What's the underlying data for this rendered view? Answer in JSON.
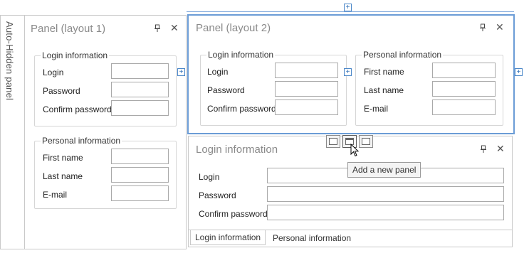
{
  "auto_hidden": {
    "label": "Auto-Hidden panel"
  },
  "panel1": {
    "title": "Panel (layout 1)",
    "login_group": {
      "caption": "Login information",
      "fields": [
        {
          "label": "Login",
          "value": ""
        },
        {
          "label": "Password",
          "value": ""
        },
        {
          "label": "Confirm password",
          "value": ""
        }
      ]
    },
    "personal_group": {
      "caption": "Personal information",
      "fields": [
        {
          "label": "First name",
          "value": ""
        },
        {
          "label": "Last name",
          "value": ""
        },
        {
          "label": "E-mail",
          "value": ""
        }
      ]
    }
  },
  "panel2": {
    "title": "Panel (layout 2)",
    "login_group": {
      "caption": "Login information",
      "fields": [
        {
          "label": "Login",
          "value": ""
        },
        {
          "label": "Password",
          "value": ""
        },
        {
          "label": "Confirm password",
          "value": ""
        }
      ]
    },
    "personal_group": {
      "caption": "Personal information",
      "fields": [
        {
          "label": "First name",
          "value": ""
        },
        {
          "label": "Last name",
          "value": ""
        },
        {
          "label": "E-mail",
          "value": ""
        }
      ]
    }
  },
  "panel3": {
    "title": "Login information",
    "fields": [
      {
        "label": "Login",
        "value": ""
      },
      {
        "label": "Password",
        "value": ""
      },
      {
        "label": "Confirm password",
        "value": ""
      }
    ],
    "tabs": [
      {
        "label": "Login information",
        "active": true
      },
      {
        "label": "Personal information",
        "active": false
      }
    ]
  },
  "tooltip": {
    "text": "Add a new panel"
  },
  "icons": {
    "pin": "pin-icon",
    "close": "close-icon",
    "plus": "plus-icon"
  },
  "colors": {
    "accent": "#4a86c8",
    "border": "#c9c9c9"
  }
}
